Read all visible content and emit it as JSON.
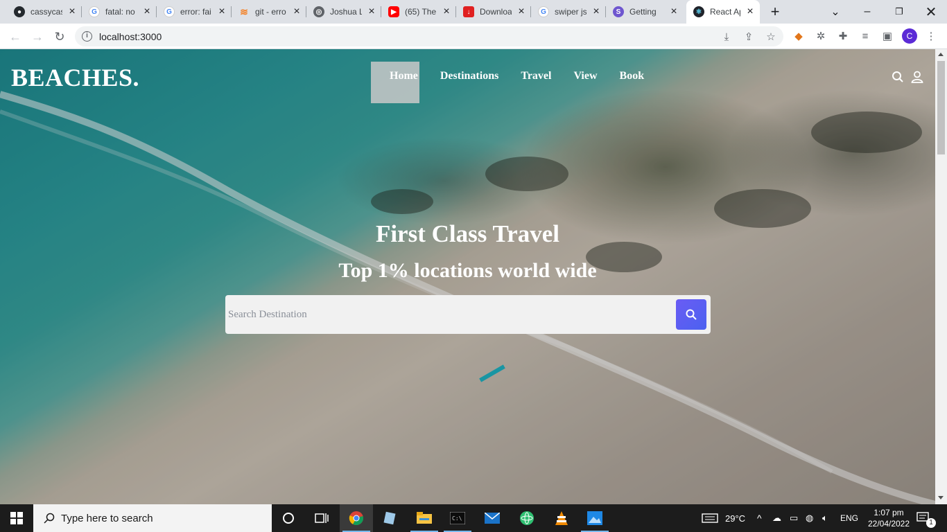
{
  "browser": {
    "tabs": [
      {
        "title": "cassycas",
        "icon": "github-icon",
        "color": "#24292e"
      },
      {
        "title": "fatal: no",
        "icon": "google-icon",
        "color": "#4285f4"
      },
      {
        "title": "error: fai",
        "icon": "google-icon",
        "color": "#4285f4"
      },
      {
        "title": "git - erro",
        "icon": "stackoverflow-icon",
        "color": "#f48024"
      },
      {
        "title": "Joshua L",
        "icon": "globe-icon",
        "color": "#5f6368"
      },
      {
        "title": "(65) The",
        "icon": "youtube-icon",
        "color": "#ff0000"
      },
      {
        "title": "Downloa",
        "icon": "download-icon",
        "color": "#e02020"
      },
      {
        "title": "swiper js",
        "icon": "google-icon",
        "color": "#4285f4"
      },
      {
        "title": "Getting",
        "icon": "stitches-icon",
        "color": "#6e56cf"
      },
      {
        "title": "React Ap",
        "icon": "react-icon",
        "color": "#20232a",
        "active": true
      }
    ],
    "url": "localhost:3000",
    "profile_initial": "C"
  },
  "page": {
    "logo": "BEACHES.",
    "nav": [
      "Home",
      "Destinations",
      "Travel",
      "View",
      "Book"
    ],
    "hero_title": "First Class Travel",
    "hero_subtitle": "Top 1% locations world wide",
    "search_placeholder": "Search Destination"
  },
  "taskbar": {
    "search_placeholder": "Type here to search",
    "weather": "29°C",
    "language": "ENG",
    "time": "1:07 pm",
    "date": "22/04/2022",
    "notification_count": "1"
  },
  "colors": {
    "accent": "#5b5ff2",
    "tab_strip": "#dee1e6",
    "taskbar": "#1c1c1c"
  }
}
